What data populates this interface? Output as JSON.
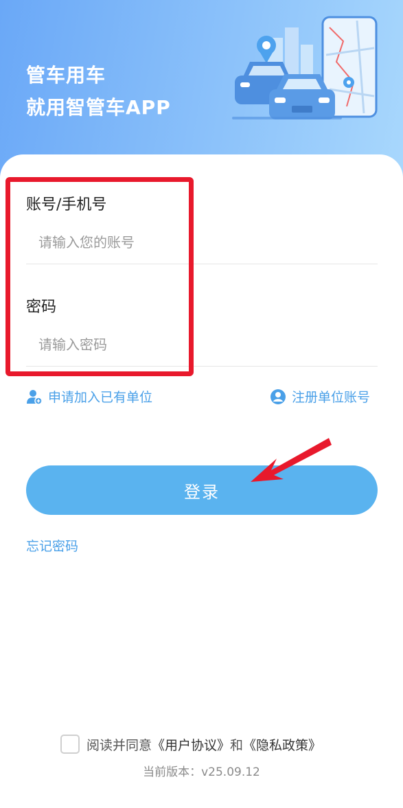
{
  "header": {
    "line1": "管车用车",
    "line2": "就用智管车APP"
  },
  "form": {
    "account_label": "账号/手机号",
    "account_placeholder": "请输入您的账号",
    "password_label": "密码",
    "password_placeholder": "请输入密码"
  },
  "links": {
    "join_unit": "申请加入已有单位",
    "register_unit": "注册单位账号",
    "forgot_password": "忘记密码"
  },
  "login_button": "登录",
  "agreement": {
    "prefix": "阅读并同意",
    "user_agreement": "《用户协议》",
    "and": "和",
    "privacy_policy": "《隐私政策》"
  },
  "version": "当前版本：v25.09.12",
  "colors": {
    "accent": "#5ab3ef",
    "link": "#4aa0e8",
    "highlight": "#e8192c"
  }
}
